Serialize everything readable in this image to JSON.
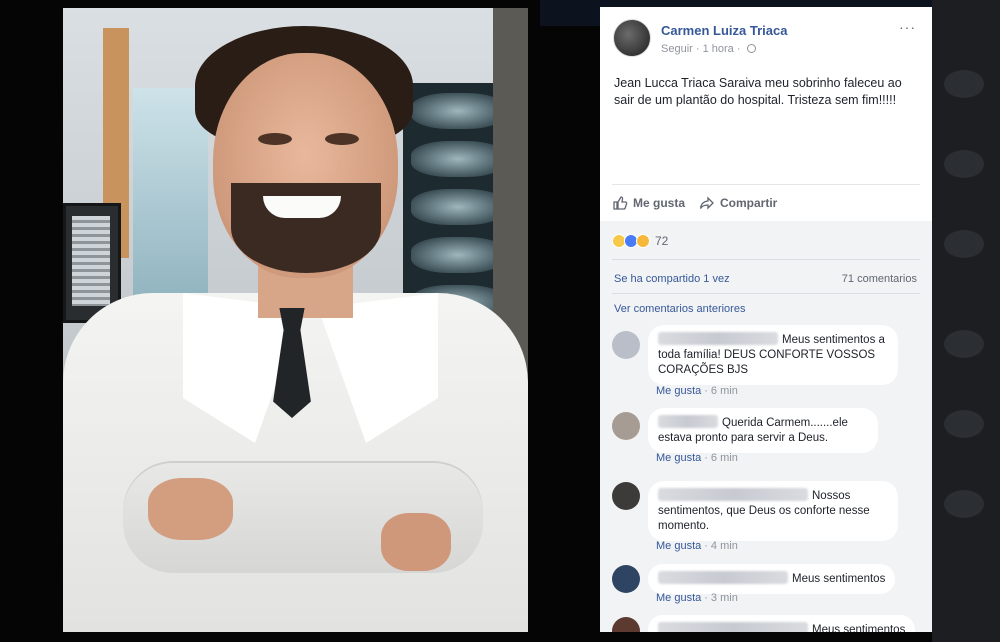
{
  "post": {
    "author": "Carmen Luiza Triaca",
    "follow": "Seguir",
    "time": "1 hora",
    "more": "···",
    "text": "Jean Lucca Triaca Saraiva meu sobrinho faleceu ao sair de um plantão do hospital. Tristeza sem fim!!!!!",
    "like_label": "Me gusta",
    "share_label": "Compartir"
  },
  "stats": {
    "reactions": "72",
    "shares": "Se ha compartido 1 vez",
    "comments": "71 comentarios",
    "previous": "Ver comentarios anteriores"
  },
  "comments": [
    {
      "text": "Meus sentimentos a toda família! DEUS CONFORTE VOSSOS CORAÇÕES BJS",
      "like": "Me gusta",
      "time": "6 min"
    },
    {
      "text": "Querida Carmem.......ele estava pronto para servir a Deus.",
      "like": "Me gusta",
      "time": "6 min"
    },
    {
      "text": "Nossos sentimentos, que Deus os conforte nesse momento.",
      "like": "Me gusta",
      "time": "4 min"
    },
    {
      "text": "Meus sentimentos",
      "like": "Me gusta",
      "time": "3 min"
    },
    {
      "text": "Meus sentimentos"
    }
  ],
  "colors": {
    "link": "#365899",
    "panel_bg": "#ffffff",
    "comment_zone_bg": "#f2f3f5"
  },
  "icons": [
    "thumbs-up-icon",
    "share-icon",
    "globe-icon",
    "sad-reaction-icon",
    "like-reaction-icon",
    "wow-reaction-icon"
  ]
}
